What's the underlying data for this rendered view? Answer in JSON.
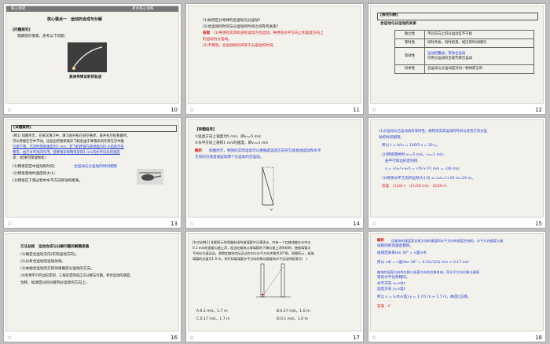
{
  "slides": [
    {
      "page": "10",
      "header_tab": "核心探究",
      "header_right": "考点核心讲练",
      "title": "核心要点一　运动的合成与分解",
      "q_heading": "[问题探究]",
      "q_prompt": "观察图示情景，思考以下问题：",
      "caption": "美洲导弹试射的轨迹"
    },
    {
      "page": "11",
      "lines": [
        "(1)如何区分导弹的合运动与分运动?",
        "(2)合运动的时间与分运动的时间之间有何关系?"
      ],
      "answer_label": "答案",
      "answer_lines": [
        "(1)导弹在实际轨迹的运动为合运动，导弹在水平方向上和竖直方向上",
        "的运动为分运动。",
        "(2)不相等，合运动的时间等于分运动的时间。"
      ]
    },
    {
      "page": "12",
      "heading": "[探究归纳]",
      "table_title": "合运动与分运动的关系",
      "rows": [
        {
          "k": "独立性",
          "v": "不同方向上的分运动互不干扰"
        },
        {
          "k": "等时性",
          "v": "同时开始，同时结束，经历的时间相同"
        },
        {
          "k": "等效性",
          "v1": "运动的叠加，等效合运动",
          "v2": "可用分运动的合成代替合运动"
        },
        {
          "k": "同体性",
          "v": "合运动与分运动是对同一物体而言的"
        }
      ]
    },
    {
      "page": "13",
      "heading": "[试题案例]",
      "lines": [
        "[例1] 如图所示，在某次演习中，演习直升机在低空悬停，直升机空投救援时，",
        "可以停留在空中不动，设投出的物资离开飞机后由于降落伞的作用在空中能",
        "匀速下落，无风时落地速度为5 m/s，若飞机停留在离地面100 m高处空投",
        "物资，由于水平风的作用，使降落伞和物资获得1 m/s的水平向北的速度",
        "求：(结果可保留根式)",
        "(1)物资在空中运动的时间；",
        "(2)物资落地时速度的大小；",
        "(3)物资在下落过程中水平方向移动的距离。"
      ],
      "side_note": "合运动与分运动的时间相等"
    },
    {
      "page": "14",
      "heading": "【审题指导】",
      "lines": [
        "①竖直方向上速度为5 m/s，即v₁=5 m/s",
        "②水平方向上获得1 m/s的速度，即v₂=1 m/s"
      ],
      "jiexi": "解析",
      "body": [
        "如图所示，物资的实际运动可以看做是竖直方向的匀速直线运动和水平",
        "方向的匀速直线运动两个分运动的合运动。"
      ],
      "label_v": "v"
    },
    {
      "page": "15",
      "lines": [
        "(1)分运动与合运动具有等时性，故物资实际运动的时间与竖直方向分运",
        "动的时间相等。",
        "所以 t = h/v₁ = 100/5 s = 20 s。",
        "(2)物资落地时 v₁=5 m/s，v₂=1 m/s，",
        "由平行四边形定则得",
        "v = √(v₁²+v₂²) = √(5²+1²) m/s = √26 m/s",
        "(3)物资水平方向的位移大小为 x=v₂t=1×20 m=20 m。"
      ],
      "answer": "答案　(1)20 s　(2)√26 m/s　(3)20 m"
    },
    {
      "page": "16",
      "lines": [
        "方法总结　运动合成与分解问题的解题思路",
        "(1)确定合运动方向(实际运动方向)。",
        "(2)分析合运动的运动效果。",
        "(3)依据合运动的实际效果确定分运动的方向。",
        "(4)利用平行四边形定则、三角形定则或正交分解法作图，将合运动的速度、",
        "位移、加速度分别分解到分运动的方向上。"
      ]
    },
    {
      "page": "17",
      "lines": [
        "[针对训练1] 如图所示的两端封闭的玻璃管中注满清水，内有一个红蜡块能在水中以",
        "0.1 m/s的速度匀速上浮，现当红蜡块从玻璃管的下端匀速上浮的同时，使玻璃管水",
        "平向右匀速运动，测得红蜡块实际运动方向与水平方向夹角为30°角，如图所示，若玻",
        "璃管的长度为1.0 m，则可知玻璃管水平方向的移动速度和水平运动的距离为(　)"
      ],
      "options": [
        "A.0.1 m/s，1.7 m",
        "B.0.17 m/s，1.0 m",
        "C.0.17 m/s，1.7 m",
        "D.0.1 m/s，1.0 m"
      ]
    },
    {
      "page": "18",
      "jiexi": "解析",
      "lines": [
        "红蜡块的速度是竖直方向的速度和水平方向的速度合成的，水平方向速度与玻",
        "璃管的移动速度相同。",
        "由速度关系tan 30° = v竖/v水",
        "所以 v水 = v竖/tan 30° = 0.1/(√3/3) m/s ≈ 0.17 m/s",
        "蜡块的竖直方向的位移与竖直方向的位移合成，而水平方向位移与玻璃",
        "管的水平位移相同。",
        "水平方向 x=v水t",
        "竖直方向 y=v竖t",
        "所以 x = (v水/v竖)·y = 1.7/1 m ≈ 1.7 m，故选C正确。"
      ],
      "answer": "答案　C"
    }
  ],
  "star": "☆"
}
